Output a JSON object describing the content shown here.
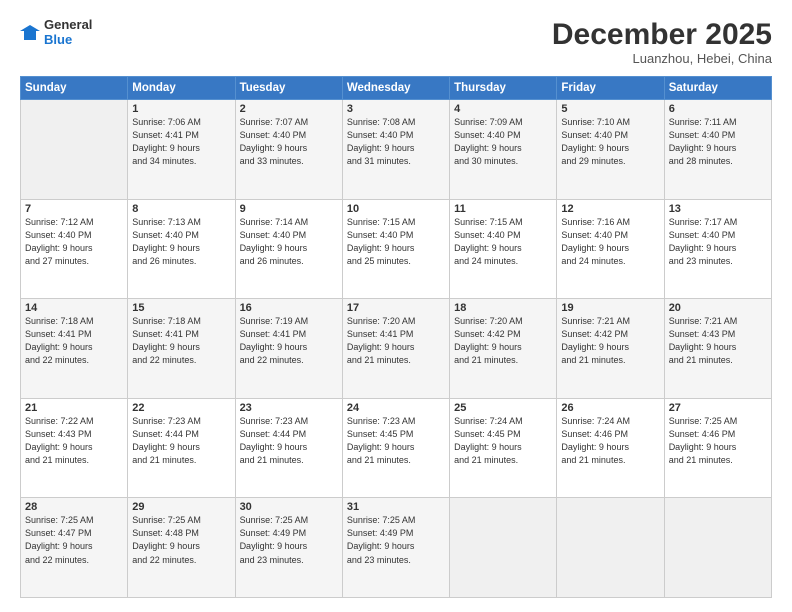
{
  "logo": {
    "line1": "General",
    "line2": "Blue"
  },
  "title": "December 2025",
  "location": "Luanzhou, Hebei, China",
  "days_of_week": [
    "Sunday",
    "Monday",
    "Tuesday",
    "Wednesday",
    "Thursday",
    "Friday",
    "Saturday"
  ],
  "weeks": [
    [
      {
        "num": "",
        "info": ""
      },
      {
        "num": "1",
        "info": "Sunrise: 7:06 AM\nSunset: 4:41 PM\nDaylight: 9 hours\nand 34 minutes."
      },
      {
        "num": "2",
        "info": "Sunrise: 7:07 AM\nSunset: 4:40 PM\nDaylight: 9 hours\nand 33 minutes."
      },
      {
        "num": "3",
        "info": "Sunrise: 7:08 AM\nSunset: 4:40 PM\nDaylight: 9 hours\nand 31 minutes."
      },
      {
        "num": "4",
        "info": "Sunrise: 7:09 AM\nSunset: 4:40 PM\nDaylight: 9 hours\nand 30 minutes."
      },
      {
        "num": "5",
        "info": "Sunrise: 7:10 AM\nSunset: 4:40 PM\nDaylight: 9 hours\nand 29 minutes."
      },
      {
        "num": "6",
        "info": "Sunrise: 7:11 AM\nSunset: 4:40 PM\nDaylight: 9 hours\nand 28 minutes."
      }
    ],
    [
      {
        "num": "7",
        "info": "Sunrise: 7:12 AM\nSunset: 4:40 PM\nDaylight: 9 hours\nand 27 minutes."
      },
      {
        "num": "8",
        "info": "Sunrise: 7:13 AM\nSunset: 4:40 PM\nDaylight: 9 hours\nand 26 minutes."
      },
      {
        "num": "9",
        "info": "Sunrise: 7:14 AM\nSunset: 4:40 PM\nDaylight: 9 hours\nand 26 minutes."
      },
      {
        "num": "10",
        "info": "Sunrise: 7:15 AM\nSunset: 4:40 PM\nDaylight: 9 hours\nand 25 minutes."
      },
      {
        "num": "11",
        "info": "Sunrise: 7:15 AM\nSunset: 4:40 PM\nDaylight: 9 hours\nand 24 minutes."
      },
      {
        "num": "12",
        "info": "Sunrise: 7:16 AM\nSunset: 4:40 PM\nDaylight: 9 hours\nand 24 minutes."
      },
      {
        "num": "13",
        "info": "Sunrise: 7:17 AM\nSunset: 4:40 PM\nDaylight: 9 hours\nand 23 minutes."
      }
    ],
    [
      {
        "num": "14",
        "info": "Sunrise: 7:18 AM\nSunset: 4:41 PM\nDaylight: 9 hours\nand 22 minutes."
      },
      {
        "num": "15",
        "info": "Sunrise: 7:18 AM\nSunset: 4:41 PM\nDaylight: 9 hours\nand 22 minutes."
      },
      {
        "num": "16",
        "info": "Sunrise: 7:19 AM\nSunset: 4:41 PM\nDaylight: 9 hours\nand 22 minutes."
      },
      {
        "num": "17",
        "info": "Sunrise: 7:20 AM\nSunset: 4:41 PM\nDaylight: 9 hours\nand 21 minutes."
      },
      {
        "num": "18",
        "info": "Sunrise: 7:20 AM\nSunset: 4:42 PM\nDaylight: 9 hours\nand 21 minutes."
      },
      {
        "num": "19",
        "info": "Sunrise: 7:21 AM\nSunset: 4:42 PM\nDaylight: 9 hours\nand 21 minutes."
      },
      {
        "num": "20",
        "info": "Sunrise: 7:21 AM\nSunset: 4:43 PM\nDaylight: 9 hours\nand 21 minutes."
      }
    ],
    [
      {
        "num": "21",
        "info": "Sunrise: 7:22 AM\nSunset: 4:43 PM\nDaylight: 9 hours\nand 21 minutes."
      },
      {
        "num": "22",
        "info": "Sunrise: 7:23 AM\nSunset: 4:44 PM\nDaylight: 9 hours\nand 21 minutes."
      },
      {
        "num": "23",
        "info": "Sunrise: 7:23 AM\nSunset: 4:44 PM\nDaylight: 9 hours\nand 21 minutes."
      },
      {
        "num": "24",
        "info": "Sunrise: 7:23 AM\nSunset: 4:45 PM\nDaylight: 9 hours\nand 21 minutes."
      },
      {
        "num": "25",
        "info": "Sunrise: 7:24 AM\nSunset: 4:45 PM\nDaylight: 9 hours\nand 21 minutes."
      },
      {
        "num": "26",
        "info": "Sunrise: 7:24 AM\nSunset: 4:46 PM\nDaylight: 9 hours\nand 21 minutes."
      },
      {
        "num": "27",
        "info": "Sunrise: 7:25 AM\nSunset: 4:46 PM\nDaylight: 9 hours\nand 21 minutes."
      }
    ],
    [
      {
        "num": "28",
        "info": "Sunrise: 7:25 AM\nSunset: 4:47 PM\nDaylight: 9 hours\nand 22 minutes."
      },
      {
        "num": "29",
        "info": "Sunrise: 7:25 AM\nSunset: 4:48 PM\nDaylight: 9 hours\nand 22 minutes."
      },
      {
        "num": "30",
        "info": "Sunrise: 7:25 AM\nSunset: 4:49 PM\nDaylight: 9 hours\nand 23 minutes."
      },
      {
        "num": "31",
        "info": "Sunrise: 7:25 AM\nSunset: 4:49 PM\nDaylight: 9 hours\nand 23 minutes."
      },
      {
        "num": "",
        "info": ""
      },
      {
        "num": "",
        "info": ""
      },
      {
        "num": "",
        "info": ""
      }
    ]
  ]
}
